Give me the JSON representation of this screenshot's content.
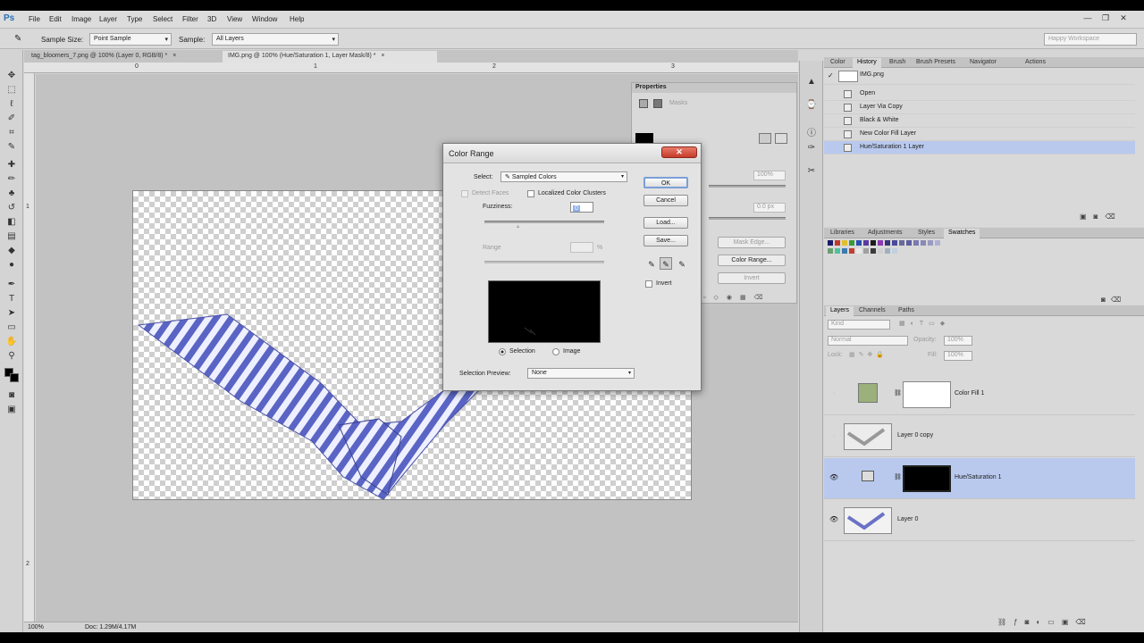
{
  "app": {
    "logo": "Ps"
  },
  "menu": [
    "File",
    "Edit",
    "Image",
    "Layer",
    "Type",
    "Select",
    "Filter",
    "3D",
    "View",
    "Window",
    "Help"
  ],
  "window_buttons": [
    "—",
    "❐",
    "✕"
  ],
  "options_bar": {
    "sample_size_label": "Sample Size:",
    "sample_size_value": "Point Sample",
    "sample_label": "Sample:",
    "sample_value": "All Layers",
    "workspace": "Happy Workspace"
  },
  "doc_tabs": [
    {
      "label": "tag_bloomers_7.png @ 100% (Layer 0, RGB/8) *",
      "close": "×"
    },
    {
      "label": "IMG.png @ 100% (Hue/Saturation 1, Layer Mask/8) *",
      "close": "×"
    }
  ],
  "ruler": {
    "h": [
      "0",
      "1",
      "2",
      "3"
    ],
    "v": [
      "1",
      "2"
    ]
  },
  "status": {
    "zoom": "100%",
    "doc": "Doc: 1.29M/4.17M"
  },
  "properties": {
    "title": "Properties",
    "subtitle": "Masks",
    "density": "100%",
    "feather": "0.0 px",
    "mask_edge_btn": "Mask Edge...",
    "color_range_btn": "Color Range...",
    "invert_btn": "Invert"
  },
  "history_panel": {
    "tabs": [
      "Color",
      "History",
      "Brush",
      "Brush Presets",
      "Navigator",
      "Actions"
    ],
    "active_tab": "History",
    "snapshot": "IMG.png",
    "items": [
      "Open",
      "Layer Via Copy",
      "Black & White",
      "New Color Fill Layer",
      "Hue/Saturation 1 Layer"
    ],
    "selected_index": 4
  },
  "swatches_panel": {
    "tabs": [
      "Libraries",
      "Adjustments",
      "Styles",
      "Swatches"
    ],
    "active_tab": "Swatches",
    "colors_row1": [
      "#1b1b6b",
      "#c03b2b",
      "#e0c030",
      "#3a9a3a",
      "#2b4fb0",
      "#5a3aa0",
      "#1c1c1c",
      "#8a3bb3",
      "#35357a",
      "#4a4a9a",
      "#6a6a9a",
      "#5e5ea0",
      "#7a7ab0",
      "#8a8ab5",
      "#9a9ac0",
      "#b0b0d5"
    ],
    "colors_row2": [
      "#6aa070",
      "#50c0a0",
      "#3a7ab0",
      "#c04030",
      "#e8e8e8",
      "#a0a0a0",
      "#3a3a3a",
      "#d0d0d0",
      "#a0b0c0",
      "#c0d0e0"
    ]
  },
  "layers_panel": {
    "tabs": [
      "Layers",
      "Channels",
      "Paths"
    ],
    "active_tab": "Layers",
    "kind": "Kind",
    "blend": "Normal",
    "opacity_label": "Opacity:",
    "opacity": "100%",
    "lock_label": "Lock:",
    "fill_label": "Fill:",
    "fill": "100%",
    "layers": [
      {
        "name": "Color Fill 1",
        "visible": false,
        "selected": false
      },
      {
        "name": "Layer 0 copy",
        "visible": false,
        "selected": false
      },
      {
        "name": "Hue/Saturation 1",
        "visible": true,
        "selected": true
      },
      {
        "name": "Layer 0",
        "visible": true,
        "selected": false
      }
    ]
  },
  "dialog": {
    "title": "Color Range",
    "close": "✕",
    "select_label": "Select:",
    "select_value": "Sampled Colors",
    "detect_faces": "Detect Faces",
    "localized": "Localized Color Clusters",
    "fuzziness_label": "Fuzziness:",
    "fuzziness": "0",
    "range_label": "Range",
    "range_unit": "%",
    "radio_selection": "Selection",
    "radio_image": "Image",
    "preview_label": "Selection Preview:",
    "preview_value": "None",
    "ok": "OK",
    "cancel": "Cancel",
    "load": "Load...",
    "save": "Save...",
    "invert": "Invert"
  }
}
